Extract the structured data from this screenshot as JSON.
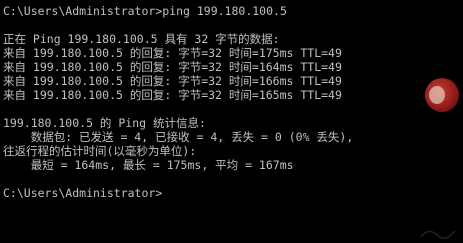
{
  "console": {
    "command_line": "C:\\Users\\Administrator>ping 199.180.100.5",
    "pinging_line": "正在 Ping 199.180.100.5 具有 32 字节的数据:",
    "replies": [
      "来自 199.180.100.5 的回复: 字节=32 时间=175ms TTL=49",
      "来自 199.180.100.5 的回复: 字节=32 时间=164ms TTL=49",
      "来自 199.180.100.5 的回复: 字节=32 时间=166ms TTL=49",
      "来自 199.180.100.5 的回复: 字节=32 时间=165ms TTL=49"
    ],
    "stats_header": "199.180.100.5 的 Ping 统计信息:",
    "packets_line": "    数据包: 已发送 = 4, 已接收 = 4, 丢失 = 0 (0% 丢失),",
    "rtt_header": "往返行程的估计时间(以毫秒为单位):",
    "rtt_values": "    最短 = 164ms, 最长 = 175ms, 平均 = 167ms",
    "final_prompt": "C:\\Users\\Administrator>"
  },
  "colors": {
    "background": "#000000",
    "text": "#c0c0c0"
  }
}
